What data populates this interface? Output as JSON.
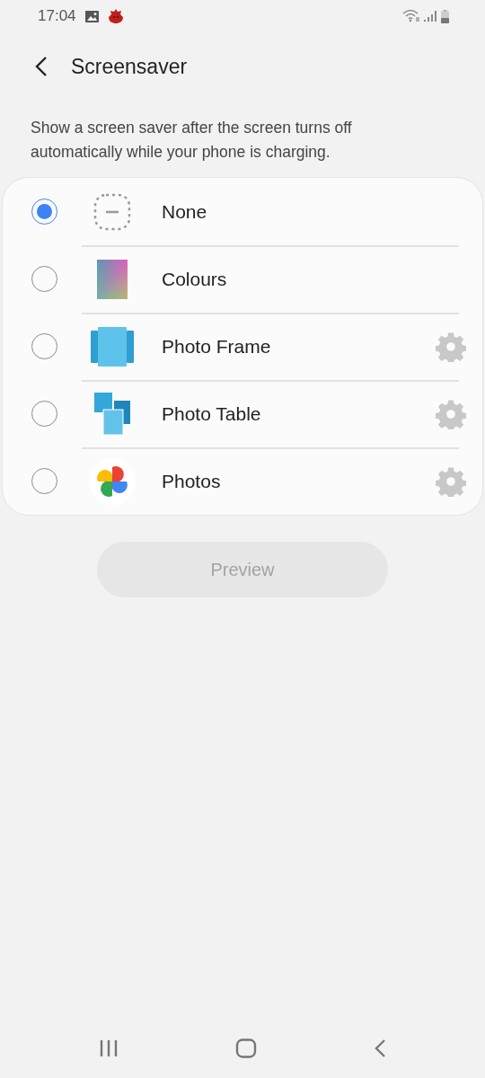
{
  "status_bar": {
    "time": "17:04"
  },
  "header": {
    "title": "Screensaver"
  },
  "description": "Show a screen saver after the screen turns off automatically while your phone is charging.",
  "options": [
    {
      "label": "None",
      "kind": "none",
      "selected": true,
      "settings": false
    },
    {
      "label": "Colours",
      "kind": "colours",
      "selected": false,
      "settings": false
    },
    {
      "label": "Photo Frame",
      "kind": "frame",
      "selected": false,
      "settings": true
    },
    {
      "label": "Photo Table",
      "kind": "table",
      "selected": false,
      "settings": true
    },
    {
      "label": "Photos",
      "kind": "photos",
      "selected": false,
      "settings": true
    }
  ],
  "preview_button": {
    "label": "Preview",
    "disabled": true
  }
}
